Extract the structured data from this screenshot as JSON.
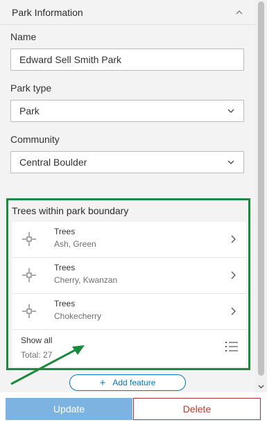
{
  "section": {
    "title": "Park Information",
    "collapse_icon": "chevron-up-icon"
  },
  "fields": {
    "name": {
      "label": "Name",
      "value": "Edward Sell Smith Park"
    },
    "park_type": {
      "label": "Park type",
      "value": "Park"
    },
    "community": {
      "label": "Community",
      "value": "Central Boulder"
    }
  },
  "related": {
    "title": "Trees within park boundary",
    "highlight_color": "#1a8a3c",
    "items": [
      {
        "title": "Trees",
        "subtitle": "Ash, Green",
        "icon": "point-feature-icon"
      },
      {
        "title": "Trees",
        "subtitle": "Cherry, Kwanzan",
        "icon": "point-feature-icon"
      },
      {
        "title": "Trees",
        "subtitle": "Chokecherry",
        "icon": "point-feature-icon"
      }
    ],
    "show_all_label": "Show all",
    "total_label": "Total: 27"
  },
  "add_feature": {
    "label": "Add feature",
    "icon": "plus-icon"
  },
  "footer": {
    "update_label": "Update",
    "delete_label": "Delete"
  },
  "colors": {
    "accent": "#007ac2",
    "update_bg": "#7db3e0",
    "delete_text": "#c0392b"
  }
}
